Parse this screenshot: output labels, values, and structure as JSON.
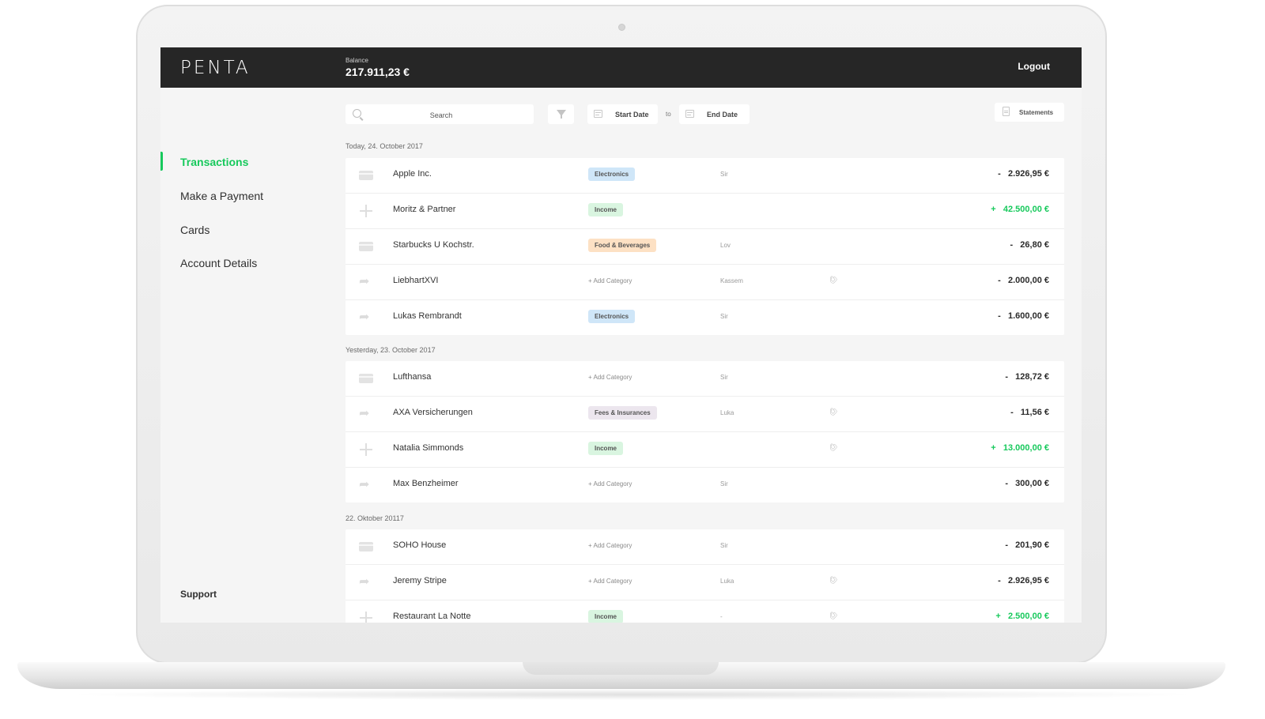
{
  "app": {
    "logo": "PENTA"
  },
  "header": {
    "balance_label": "Balance",
    "balance_value": "217.911,23 €",
    "logout_label": "Logout"
  },
  "sidebar": {
    "items": [
      {
        "label": "Transactions",
        "active": true
      },
      {
        "label": "Make a Payment",
        "active": false
      },
      {
        "label": "Cards",
        "active": false
      },
      {
        "label": "Account Details",
        "active": false
      }
    ],
    "support_label": "Support"
  },
  "toolbar": {
    "search_placeholder": "Search",
    "start_date_label": "Start Date",
    "to_label": "to",
    "end_date_label": "End Date",
    "statements_label": "Statements"
  },
  "colors": {
    "accent": "#17c95c",
    "topbar": "#262626"
  },
  "groups": [
    {
      "label": "Today, 24. October 2017",
      "rows": [
        {
          "icon": "card-icon",
          "name": "Apple Inc.",
          "category": "Electronics",
          "category_style": "electronics",
          "person": "Sir",
          "attachment": false,
          "amount": "-   2.926,95 €",
          "positive": false
        },
        {
          "icon": "plus-icon",
          "name": "Moritz & Partner",
          "category": "Income",
          "category_style": "income",
          "person": "",
          "attachment": false,
          "amount": "+   42.500,00 €",
          "positive": true
        },
        {
          "icon": "card-icon",
          "name": "Starbucks U Kochstr.",
          "category": "Food & Beverages",
          "category_style": "food",
          "person": "Lov",
          "attachment": false,
          "amount": "-   26,80 €",
          "positive": false
        },
        {
          "icon": "transfer-icon",
          "name": "LiebhartXVI",
          "category": "+ Add Category",
          "category_style": "add",
          "person": "Kassem",
          "attachment": true,
          "amount": "-   2.000,00 €",
          "positive": false
        },
        {
          "icon": "transfer-icon",
          "name": "Lukas Rembrandt",
          "category": "Electronics",
          "category_style": "electronics",
          "person": "Sir",
          "attachment": false,
          "amount": "-   1.600,00 €",
          "positive": false
        }
      ]
    },
    {
      "label": "Yesterday, 23. October 2017",
      "rows": [
        {
          "icon": "card-icon",
          "name": "Lufthansa",
          "category": "+ Add Category",
          "category_style": "add",
          "person": "Sir",
          "attachment": false,
          "amount": "-   128,72 €",
          "positive": false
        },
        {
          "icon": "transfer-icon",
          "name": "AXA Versicherungen",
          "category": "Fees & Insurances",
          "category_style": "fees",
          "person": "Luka",
          "attachment": true,
          "amount": "-   11,56 €",
          "positive": false
        },
        {
          "icon": "plus-icon",
          "name": "Natalia Simmonds",
          "category": "Income",
          "category_style": "income",
          "person": "",
          "attachment": true,
          "amount": "+   13.000,00 €",
          "positive": true
        },
        {
          "icon": "transfer-icon",
          "name": "Max Benzheimer",
          "category": "+ Add Category",
          "category_style": "add",
          "person": "Sir",
          "attachment": false,
          "amount": "-   300,00 €",
          "positive": false
        }
      ]
    },
    {
      "label": "22. Oktober 20117",
      "rows": [
        {
          "icon": "card-icon",
          "name": "SOHO House",
          "category": "+ Add Category",
          "category_style": "add",
          "person": "Sir",
          "attachment": false,
          "amount": "-   201,90 €",
          "positive": false
        },
        {
          "icon": "transfer-icon",
          "name": "Jeremy Stripe",
          "category": "+ Add Category",
          "category_style": "add",
          "person": "Luka",
          "attachment": true,
          "amount": "-   2.926,95 €",
          "positive": false
        },
        {
          "icon": "plus-icon",
          "name": "Restaurant La Notte",
          "category": "Income",
          "category_style": "income",
          "person": "-",
          "attachment": true,
          "amount": "+   2.500,00 €",
          "positive": true
        }
      ]
    }
  ]
}
